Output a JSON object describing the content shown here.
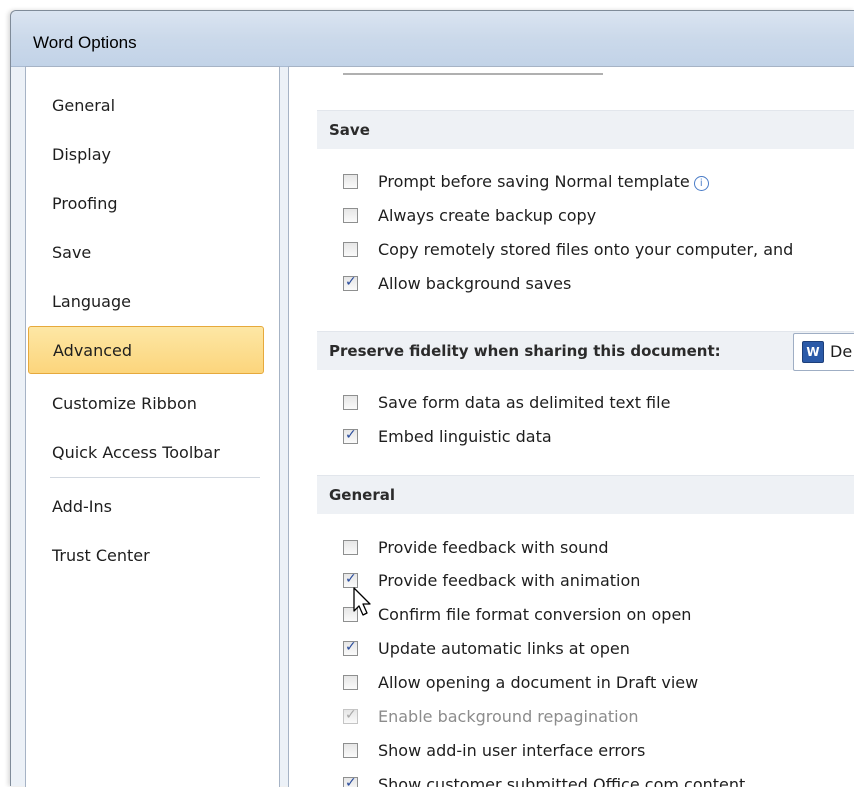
{
  "window": {
    "title": "Word Options"
  },
  "nav": {
    "items": [
      {
        "label": "General"
      },
      {
        "label": "Display"
      },
      {
        "label": "Proofing"
      },
      {
        "label": "Save"
      },
      {
        "label": "Language"
      },
      {
        "label": "Advanced",
        "active": true
      },
      {
        "label": "Customize Ribbon"
      },
      {
        "label": "Quick Access Toolbar"
      },
      {
        "label": "Add-Ins"
      },
      {
        "label": "Trust Center"
      }
    ]
  },
  "sections": {
    "save": {
      "header": "Save",
      "options": [
        {
          "label": "Prompt before saving Normal template",
          "checked": false,
          "info_icon": "info-icon"
        },
        {
          "label": "Always create backup copy",
          "checked": false
        },
        {
          "label": "Copy remotely stored files onto your computer, and",
          "checked": false
        },
        {
          "label": "Allow background saves",
          "checked": true
        }
      ]
    },
    "fidelity": {
      "header": "Preserve fidelity when sharing this document:",
      "document_value": "De",
      "document_icon": "word-document-icon",
      "options": [
        {
          "label": "Save form data as delimited text file",
          "checked": false
        },
        {
          "label": "Embed linguistic data",
          "checked": true
        }
      ]
    },
    "general": {
      "header": "General",
      "options": [
        {
          "label": "Provide feedback with sound",
          "checked": false
        },
        {
          "label": "Provide feedback with animation",
          "checked": true
        },
        {
          "label": "Confirm file format conversion on open",
          "checked": false
        },
        {
          "label": "Update automatic links at open",
          "checked": true
        },
        {
          "label": "Allow opening a document in Draft view",
          "checked": false
        },
        {
          "label": "Enable background repagination",
          "checked": true,
          "disabled": true
        },
        {
          "label": "Show add-in user interface errors",
          "checked": false
        },
        {
          "label": "Show customer submitted Office.com content",
          "checked": true
        }
      ]
    }
  },
  "colors": {
    "active_nav_bg": "#fcd57c",
    "active_nav_border": "#e6a93c",
    "check_color": "#2a4c9c"
  }
}
